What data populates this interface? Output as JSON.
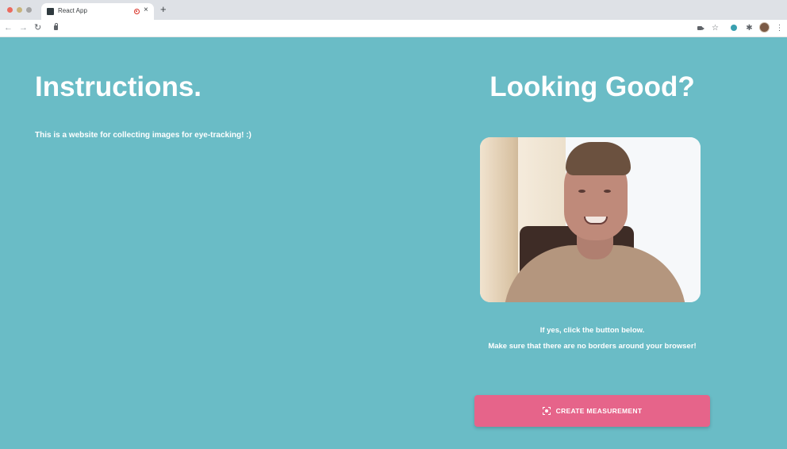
{
  "browser": {
    "tab_title": "React App",
    "new_tab_symbol": "+",
    "tab_close_symbol": "×",
    "nav_back": "←",
    "nav_forward": "→",
    "nav_reload": "↻",
    "star": "☆",
    "menu": "⋮",
    "puzzle": "✱"
  },
  "left": {
    "heading": "Instructions.",
    "intro": "This is a website for collecting images for eye-tracking! :)"
  },
  "right": {
    "heading": "Looking Good?",
    "line1": "If yes, click the button below.",
    "line2": "Make sure that there are no borders around your browser!",
    "button_label": "CREATE MEASUREMENT"
  },
  "colors": {
    "page_background": "#6abcc6",
    "button": "#e6648a",
    "text": "#ffffff"
  },
  "icons": {
    "button_icon": "center-focus-icon",
    "webcam": "webcam-preview"
  }
}
